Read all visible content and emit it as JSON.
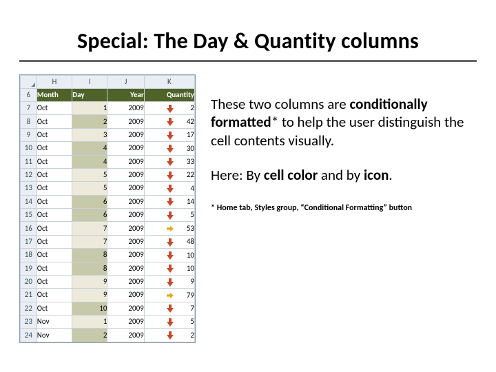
{
  "title": "Special: The Day & Quantity columns",
  "text": {
    "p1a": "These two columns are ",
    "p1b": "conditionally formatted",
    "p1c": "* to help the user distinguish the cell contents visually.",
    "p2a": "Here: By ",
    "p2b": "cell color",
    "p2c": " and by ",
    "p2d": "icon",
    "p2e": "."
  },
  "footnote": "* Home tab, Styles group, “Conditional Formatting” button",
  "sheet": {
    "col_letters": [
      "H",
      "I",
      "J",
      "K"
    ],
    "header_row_number": "6",
    "headers": {
      "month": "Month",
      "day": "Day",
      "year": "Year",
      "quantity": "Quantity"
    },
    "day_band_colors": {
      "odd": "#edeadb",
      "even": "#c6c9aa"
    },
    "rows": [
      {
        "rownum": "7",
        "month": "Oct",
        "day": 1,
        "year": 2009,
        "qty": 2,
        "arrow": "down",
        "band": "odd"
      },
      {
        "rownum": "8",
        "month": "Oct",
        "day": 2,
        "year": 2009,
        "qty": 42,
        "arrow": "down",
        "band": "even"
      },
      {
        "rownum": "9",
        "month": "Oct",
        "day": 3,
        "year": 2009,
        "qty": 17,
        "arrow": "down",
        "band": "odd"
      },
      {
        "rownum": "10",
        "month": "Oct",
        "day": 4,
        "year": 2009,
        "qty": 30,
        "arrow": "down",
        "band": "even"
      },
      {
        "rownum": "11",
        "month": "Oct",
        "day": 4,
        "year": 2009,
        "qty": 33,
        "arrow": "down",
        "band": "even"
      },
      {
        "rownum": "12",
        "month": "Oct",
        "day": 5,
        "year": 2009,
        "qty": 22,
        "arrow": "down",
        "band": "odd"
      },
      {
        "rownum": "13",
        "month": "Oct",
        "day": 5,
        "year": 2009,
        "qty": 4,
        "arrow": "down",
        "band": "odd"
      },
      {
        "rownum": "14",
        "month": "Oct",
        "day": 6,
        "year": 2009,
        "qty": 14,
        "arrow": "down",
        "band": "even"
      },
      {
        "rownum": "15",
        "month": "Oct",
        "day": 6,
        "year": 2009,
        "qty": 5,
        "arrow": "down",
        "band": "even"
      },
      {
        "rownum": "16",
        "month": "Oct",
        "day": 7,
        "year": 2009,
        "qty": 53,
        "arrow": "side",
        "band": "odd"
      },
      {
        "rownum": "17",
        "month": "Oct",
        "day": 7,
        "year": 2009,
        "qty": 48,
        "arrow": "down",
        "band": "odd"
      },
      {
        "rownum": "18",
        "month": "Oct",
        "day": 8,
        "year": 2009,
        "qty": 10,
        "arrow": "down",
        "band": "even"
      },
      {
        "rownum": "19",
        "month": "Oct",
        "day": 8,
        "year": 2009,
        "qty": 10,
        "arrow": "down",
        "band": "even"
      },
      {
        "rownum": "20",
        "month": "Oct",
        "day": 9,
        "year": 2009,
        "qty": 9,
        "arrow": "down",
        "band": "odd"
      },
      {
        "rownum": "21",
        "month": "Oct",
        "day": 9,
        "year": 2009,
        "qty": 79,
        "arrow": "side",
        "band": "odd"
      },
      {
        "rownum": "22",
        "month": "Oct",
        "day": 10,
        "year": 2009,
        "qty": 7,
        "arrow": "down",
        "band": "even"
      },
      {
        "rownum": "23",
        "month": "Nov",
        "day": 1,
        "year": 2009,
        "qty": 5,
        "arrow": "down",
        "band": "odd"
      },
      {
        "rownum": "24",
        "month": "Nov",
        "day": 2,
        "year": 2009,
        "qty": 2,
        "arrow": "down",
        "band": "even"
      }
    ]
  }
}
